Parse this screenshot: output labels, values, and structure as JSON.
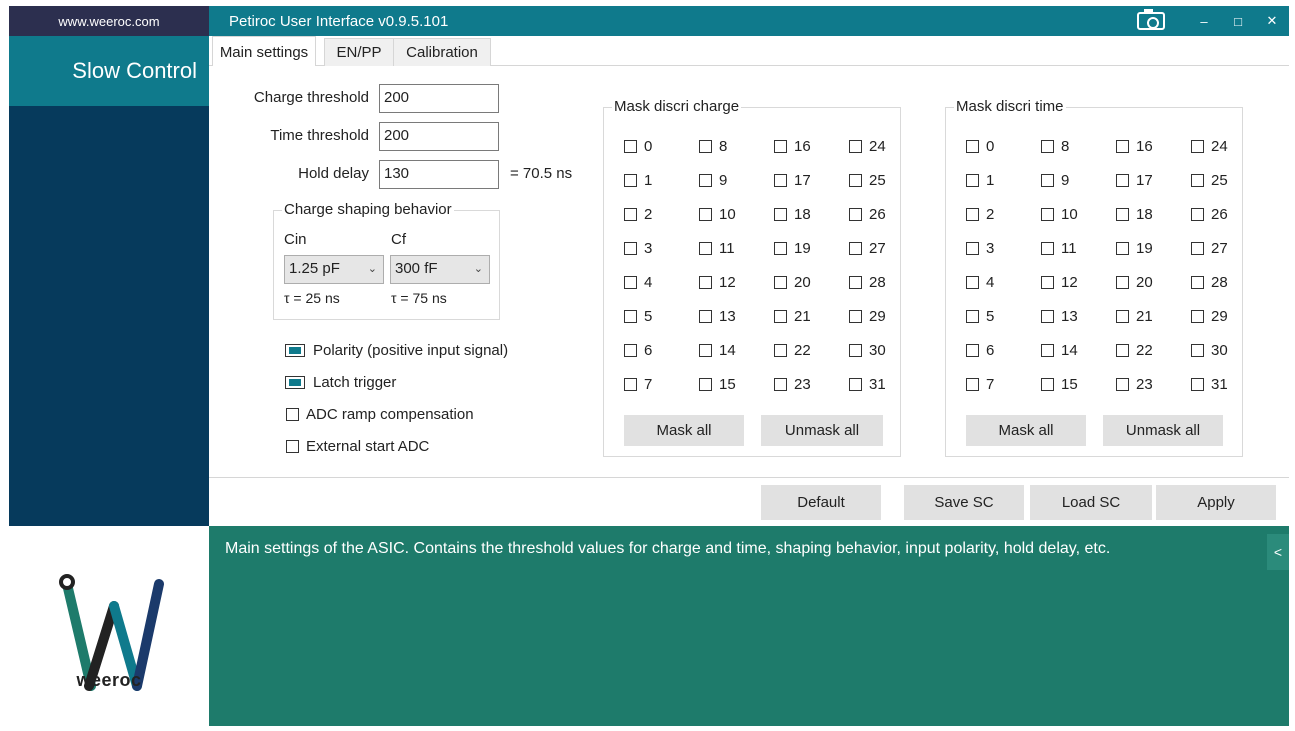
{
  "sidebar": {
    "website": "www.weeroc.com",
    "section_title": "Slow Control",
    "logo_text": "weeroc"
  },
  "window": {
    "title": "Petiroc User Interface v0.9.5.101",
    "minimize": "–",
    "maximize": "□",
    "close": "✕"
  },
  "tabs": [
    {
      "label": "Main settings",
      "active": true
    },
    {
      "label": "EN/PP",
      "active": false
    },
    {
      "label": "Calibration",
      "active": false
    }
  ],
  "main": {
    "charge_threshold_label": "Charge threshold",
    "charge_threshold_value": "200",
    "time_threshold_label": "Time threshold",
    "time_threshold_value": "200",
    "hold_delay_label": "Hold delay",
    "hold_delay_value": "130",
    "hold_delay_note": "= 70.5 ns",
    "shaping": {
      "title": "Charge shaping behavior",
      "cin_label": "Cin",
      "cin_value": "1.25 pF",
      "cin_tau": "τ = 25 ns",
      "cf_label": "Cf",
      "cf_value": "300 fF",
      "cf_tau": "τ = 75 ns"
    },
    "options": [
      {
        "label": "Polarity (positive input signal)",
        "checked": true
      },
      {
        "label": "Latch trigger",
        "checked": true
      },
      {
        "label": "ADC ramp compensation",
        "checked": false
      },
      {
        "label": "External start ADC",
        "checked": false
      }
    ]
  },
  "mask_charge": {
    "title": "Mask discri charge",
    "channels": [
      "0",
      "1",
      "2",
      "3",
      "4",
      "5",
      "6",
      "7",
      "8",
      "9",
      "10",
      "11",
      "12",
      "13",
      "14",
      "15",
      "16",
      "17",
      "18",
      "19",
      "20",
      "21",
      "22",
      "23",
      "24",
      "25",
      "26",
      "27",
      "28",
      "29",
      "30",
      "31"
    ],
    "mask_all": "Mask all",
    "unmask_all": "Unmask all"
  },
  "mask_time": {
    "title": "Mask discri time",
    "channels": [
      "0",
      "1",
      "2",
      "3",
      "4",
      "5",
      "6",
      "7",
      "8",
      "9",
      "10",
      "11",
      "12",
      "13",
      "14",
      "15",
      "16",
      "17",
      "18",
      "19",
      "20",
      "21",
      "22",
      "23",
      "24",
      "25",
      "26",
      "27",
      "28",
      "29",
      "30",
      "31"
    ],
    "mask_all": "Mask all",
    "unmask_all": "Unmask all"
  },
  "actions": {
    "default": "Default",
    "save_sc": "Save SC",
    "load_sc": "Load SC",
    "apply": "Apply"
  },
  "info": {
    "text": "Main settings of the ASIC. Contains the threshold values for charge and time, shaping behavior, input polarity, hold delay, etc.",
    "collapse": "<"
  },
  "colors": {
    "teal": "#0f7a8c",
    "navy": "#063a5c",
    "info_green": "#1e7b6b"
  }
}
